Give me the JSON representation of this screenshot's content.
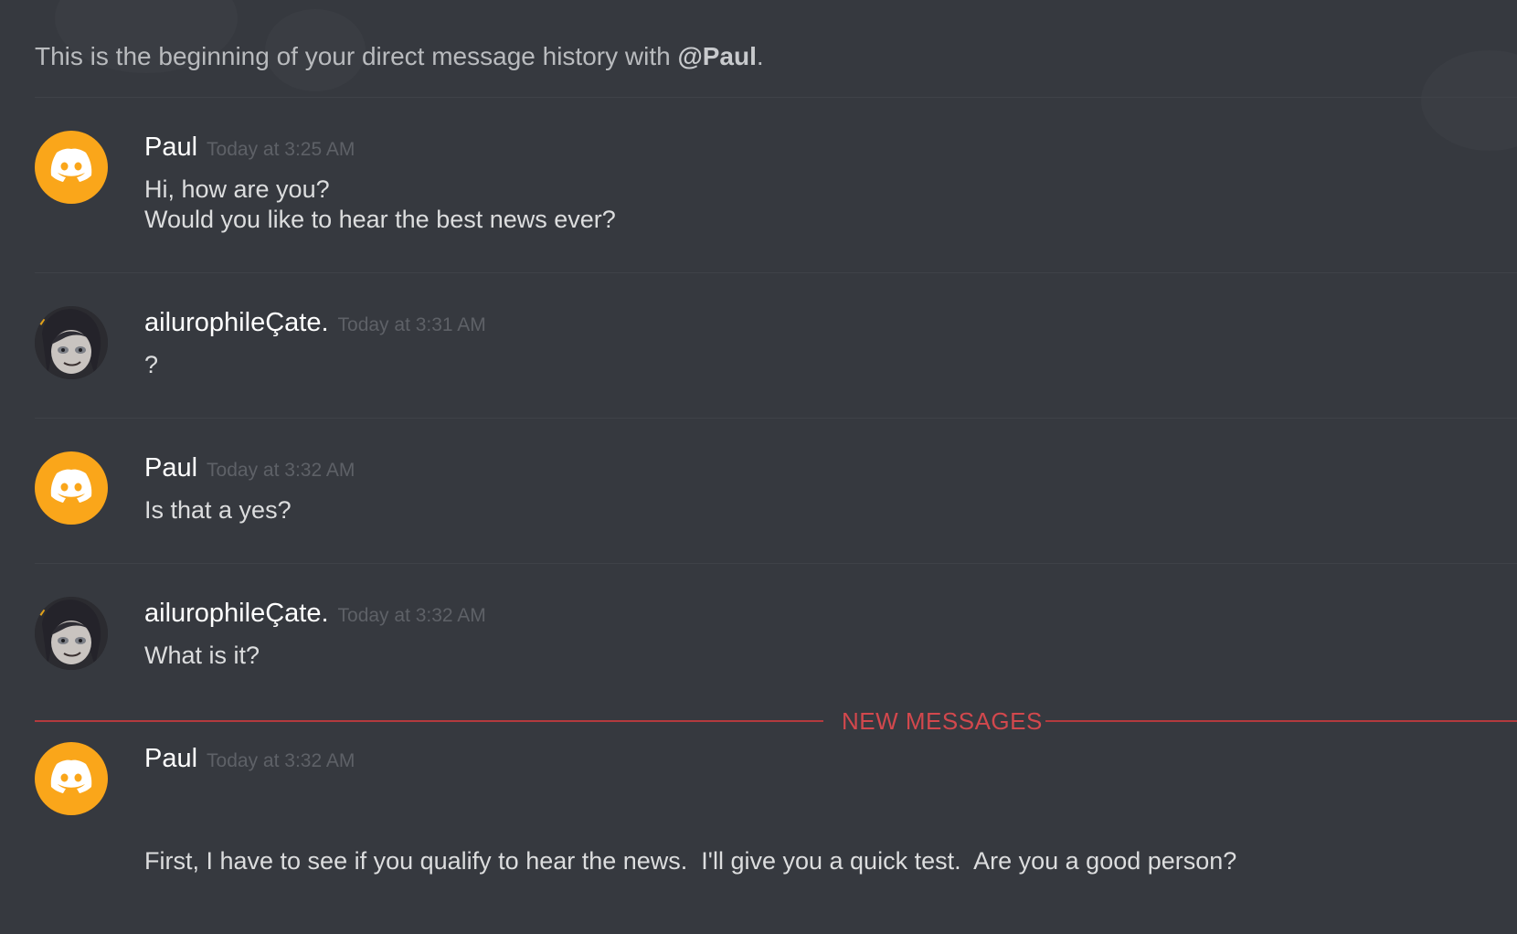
{
  "header": {
    "intro_text": "This is the beginning of your direct message history with ",
    "mention": "@Paul",
    "trailing": "."
  },
  "messages": [
    {
      "author": "Paul",
      "timestamp": "Today at 3:25 AM",
      "lines": [
        "Hi, how are you?",
        "Would you like to hear the best news ever?"
      ],
      "avatar": "discord-default-orange"
    },
    {
      "author": "ailurophileÇate.",
      "timestamp": "Today at 3:31 AM",
      "lines": [
        "?"
      ],
      "avatar": "anime-character"
    },
    {
      "author": "Paul",
      "timestamp": "Today at 3:32 AM",
      "lines": [
        "Is that a yes?"
      ],
      "avatar": "discord-default-orange"
    },
    {
      "author": "ailurophileÇate.",
      "timestamp": "Today at 3:32 AM",
      "lines": [
        "What is it?"
      ],
      "avatar": "anime-character"
    },
    {
      "author": "Paul",
      "timestamp": "Today at 3:32 AM",
      "lines": [
        "First, I have to see if you qualify to hear the news.  I'll give you a quick test.  Are you a good person?"
      ],
      "avatar": "discord-default-orange"
    }
  ],
  "new_messages_divider": "NEW MESSAGES",
  "colors": {
    "background": "#36393f",
    "avatar_orange": "#faa61a",
    "divider_red": "#d2484d",
    "author_white": "#ffffff",
    "timestamp_gray": "#5e6167"
  }
}
